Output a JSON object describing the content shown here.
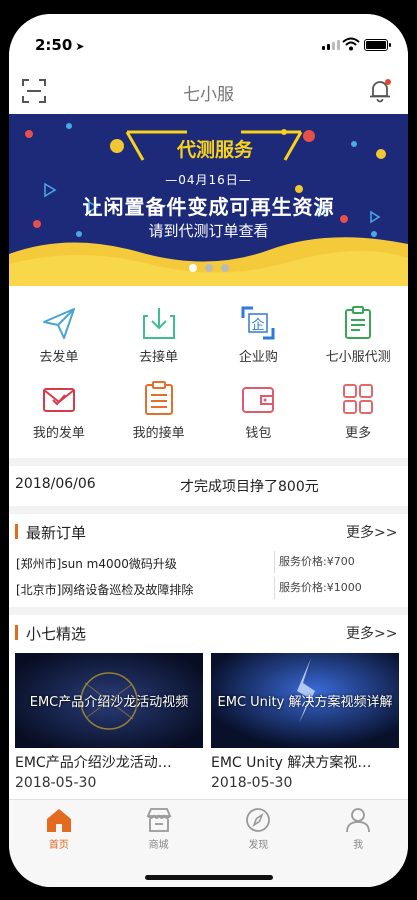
{
  "status": {
    "time": "2:50",
    "location_arrow": "➤"
  },
  "nav": {
    "title": "七小服"
  },
  "banner": {
    "title": "代测服务",
    "date": "—04月16日—",
    "headline": "让闲置备件变成可再生资源",
    "subline": "请到代测订单查看",
    "dots": 3,
    "active_dot": 0
  },
  "grid": [
    {
      "label": "去发单",
      "icon": "send-icon",
      "color": "#4aa3d8"
    },
    {
      "label": "去接单",
      "icon": "download-icon",
      "color": "#3fbf8f"
    },
    {
      "label": "企业购",
      "icon": "enterprise-icon",
      "color": "#2f7ad8"
    },
    {
      "label": "七小服代测",
      "icon": "clipboard-icon",
      "color": "#3aa657"
    },
    {
      "label": "我的发单",
      "icon": "mail-icon",
      "color": "#d83a4a"
    },
    {
      "label": "我的接单",
      "icon": "list-icon",
      "color": "#e2702a"
    },
    {
      "label": "钱包",
      "icon": "wallet-icon",
      "color": "#e05a6a"
    },
    {
      "label": "更多",
      "icon": "more-grid-icon",
      "color": "#e06a6a"
    }
  ],
  "news": {
    "date": "2018/06/06",
    "text": "才完成项目挣了800元"
  },
  "orders": {
    "title": "最新订单",
    "more": "更多>>",
    "items": [
      {
        "title": "[郑州市]sun m4000微码升级",
        "price": "服务价格:¥700"
      },
      {
        "title": "[北京市]网络设备巡检及故障排除",
        "price": "服务价格:¥1000"
      }
    ]
  },
  "featured": {
    "title": "小七精选",
    "more": "更多>>",
    "videos": [
      {
        "caption": "EMC产品介绍沙龙活动视频",
        "title": "EMC产品介绍沙龙活动…",
        "date": "2018-05-30"
      },
      {
        "caption": "EMC Unity  解决方案视频详解",
        "title": "EMC Unity  解决方案视…",
        "date": "2018-05-30"
      }
    ]
  },
  "tabs": [
    {
      "label": "首页",
      "icon": "home-icon",
      "active": true
    },
    {
      "label": "商城",
      "icon": "store-icon",
      "active": false
    },
    {
      "label": "发现",
      "icon": "compass-icon",
      "active": false
    },
    {
      "label": "我",
      "icon": "person-icon",
      "active": false
    }
  ],
  "colors": {
    "accent": "#e26b1f",
    "banner_bg": "#1d2a7a",
    "banner_yellow": "#f9d21a"
  }
}
